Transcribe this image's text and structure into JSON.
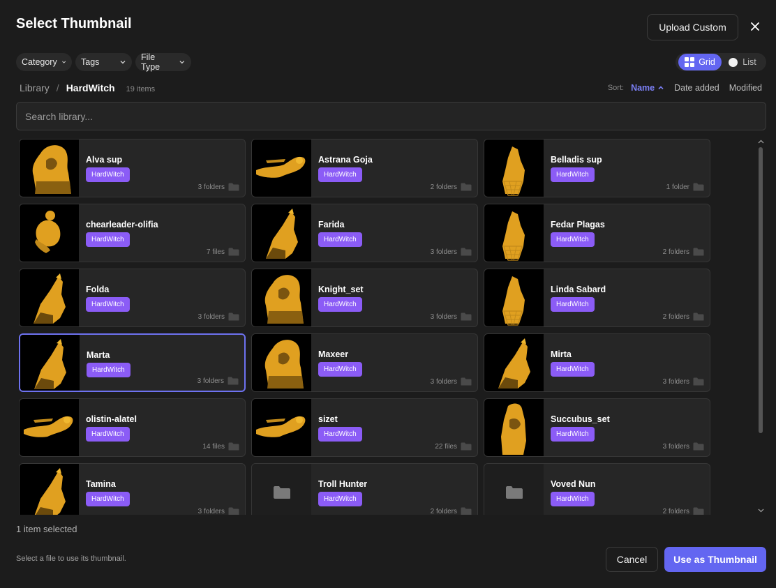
{
  "dialog": {
    "title": "Select Thumbnail",
    "upload_label": "Upload Custom",
    "close_icon": "close-icon"
  },
  "filters": [
    {
      "label": "Category"
    },
    {
      "label": "Tags"
    },
    {
      "label": "File Type"
    }
  ],
  "view_toggle": {
    "grid_label": "Grid",
    "list_label": "List",
    "active": "Grid"
  },
  "breadcrumb": {
    "root": "Library",
    "separator": "/",
    "current": "HardWitch",
    "count": "19 items"
  },
  "sort": {
    "label": "Sort:",
    "active": "Name",
    "options": [
      "Date added",
      "Modified"
    ]
  },
  "search": {
    "placeholder": "Search library...",
    "value": ""
  },
  "items": [
    {
      "name": "Alva sup",
      "tag": "HardWitch",
      "meta": "3 folders",
      "thumb": "statue"
    },
    {
      "name": "Astrana Goja",
      "tag": "HardWitch",
      "meta": "2 folders",
      "thumb": "flying"
    },
    {
      "name": "Belladis sup",
      "tag": "HardWitch",
      "meta": "1 folder",
      "thumb": "cage"
    },
    {
      "name": "chearleader-olifia",
      "tag": "HardWitch",
      "meta": "7 files",
      "thumb": "sitting"
    },
    {
      "name": "Farida",
      "tag": "HardWitch",
      "meta": "3 folders",
      "thumb": "slant"
    },
    {
      "name": "Fedar Plagas",
      "tag": "HardWitch",
      "meta": "2 folders",
      "thumb": "cage"
    },
    {
      "name": "Folda",
      "tag": "HardWitch",
      "meta": "3 folders",
      "thumb": "slant"
    },
    {
      "name": "Knight_set",
      "tag": "HardWitch",
      "meta": "3 folders",
      "thumb": "statue"
    },
    {
      "name": "Linda Sabard",
      "tag": "HardWitch",
      "meta": "2 folders",
      "thumb": "cage"
    },
    {
      "name": "Marta",
      "tag": "HardWitch",
      "meta": "3 folders",
      "thumb": "slant",
      "selected": true
    },
    {
      "name": "Maxeer",
      "tag": "HardWitch",
      "meta": "3 folders",
      "thumb": "statue"
    },
    {
      "name": "Mirta",
      "tag": "HardWitch",
      "meta": "3 folders",
      "thumb": "slant"
    },
    {
      "name": "olistin-alatel",
      "tag": "HardWitch",
      "meta": "14 files",
      "thumb": "flying"
    },
    {
      "name": "sizet",
      "tag": "HardWitch",
      "meta": "22 files",
      "thumb": "flying"
    },
    {
      "name": "Succubus_set",
      "tag": "HardWitch",
      "meta": "3 folders",
      "thumb": "block"
    },
    {
      "name": "Tamina",
      "tag": "HardWitch",
      "meta": "3 folders",
      "thumb": "slant"
    },
    {
      "name": "Troll Hunter",
      "tag": "HardWitch",
      "meta": "2 folders",
      "thumb": "folder"
    },
    {
      "name": "Voved Nun",
      "tag": "HardWitch",
      "meta": "2 folders",
      "thumb": "folder"
    }
  ],
  "footer": {
    "selected_count": "1 item selected",
    "hint": "Select a file to use its thumbnail.",
    "cancel_label": "Cancel",
    "use_label": "Use as Thumbnail"
  },
  "colors": {
    "accent": "#6366f1",
    "tag": "#8b5cf6",
    "gold": "#e0a020"
  }
}
